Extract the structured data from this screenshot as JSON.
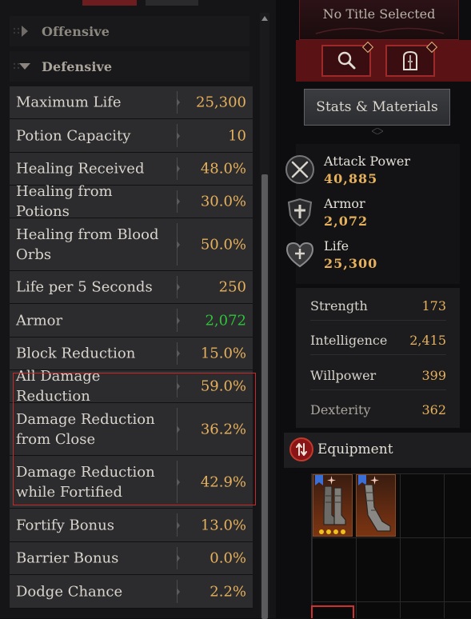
{
  "left_panel": {
    "sections": {
      "offensive": "Offensive",
      "defensive": "Defensive"
    },
    "stats": [
      {
        "name": "Maximum Life",
        "value": "25,300"
      },
      {
        "name": "Potion Capacity",
        "value": "10"
      },
      {
        "name": "Healing Received",
        "value": "48.0%"
      },
      {
        "name": "Healing from Potions",
        "value": "30.0%"
      },
      {
        "name": "Healing from Blood Orbs",
        "value": "50.0%"
      },
      {
        "name": "Life per 5 Seconds",
        "value": "250"
      },
      {
        "name": "Armor",
        "value": "2,072",
        "color": "#2ec43a"
      },
      {
        "name": "Block Reduction",
        "value": "15.0%"
      },
      {
        "name": "All Damage Reduction",
        "value": "59.0%",
        "highlighted": true
      },
      {
        "name": "Damage Reduction from Close",
        "value": "36.2%",
        "highlighted": true
      },
      {
        "name": "Damage Reduction while Fortified",
        "value": "42.9%",
        "highlighted": true
      },
      {
        "name": "Fortify Bonus",
        "value": "13.0%"
      },
      {
        "name": "Barrier Bonus",
        "value": "0.0%"
      },
      {
        "name": "Dodge Chance",
        "value": "2.2%"
      }
    ],
    "highlight_color": "#c62b2b",
    "value_color": "#e6b15c"
  },
  "right_panel": {
    "title": "No Title Selected",
    "buttons": {
      "magnifier_icon": "magnifier-icon",
      "wardrobe_icon": "wardrobe-icon",
      "stats_materials": "Stats & Materials"
    },
    "summary": {
      "attack_power": {
        "label": "Attack Power",
        "value": "40,885",
        "icon": "crossed-swords-icon"
      },
      "armor": {
        "label": "Armor",
        "value": "2,072",
        "icon": "shield-cross-icon"
      },
      "life": {
        "label": "Life",
        "value": "25,300",
        "icon": "heart-icon"
      }
    },
    "attributes": [
      {
        "name": "Strength",
        "value": "173"
      },
      {
        "name": "Intelligence",
        "value": "2,415"
      },
      {
        "name": "Willpower",
        "value": "399"
      },
      {
        "name": "Dexterity",
        "value": "362"
      }
    ],
    "equipment": {
      "title": "Equipment",
      "icon": "equipment-swap-icon",
      "items": [
        {
          "icon": "boots-icon",
          "badge": "bookmark-icon",
          "spark": "spark-icon",
          "rating_dots": 4
        },
        {
          "icon": "boots-icon",
          "badge": "bookmark-icon",
          "spark": "spark-icon",
          "rating_dots": 0
        }
      ]
    },
    "accent_color": "#8a1416"
  }
}
